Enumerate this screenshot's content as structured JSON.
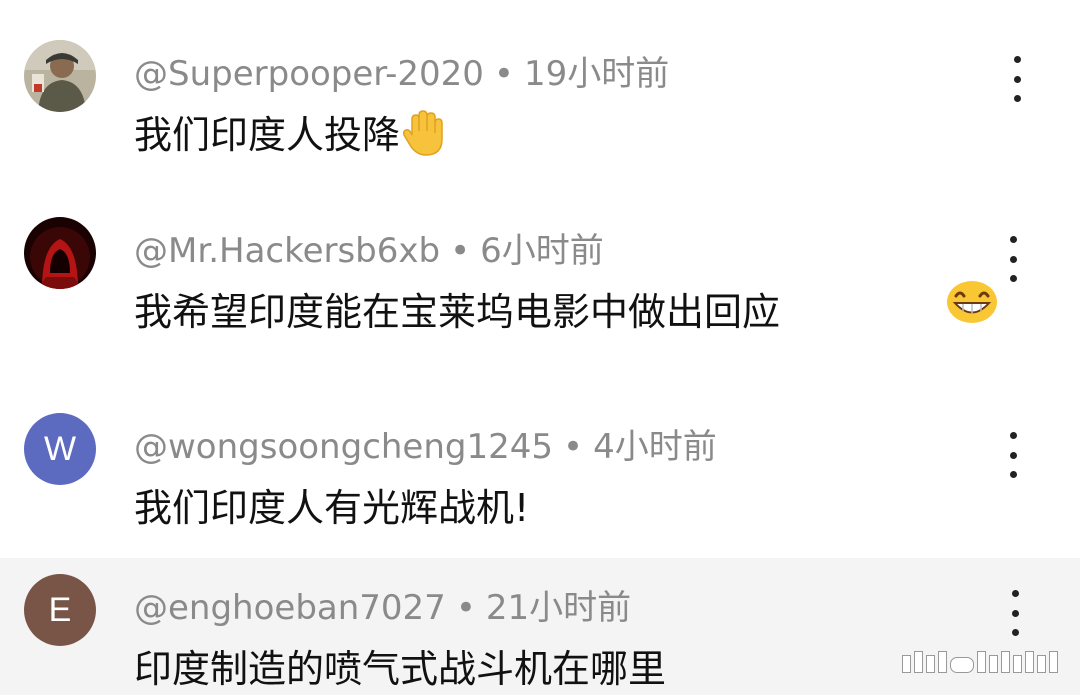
{
  "comments": [
    {
      "handle": "@Superpooper-2020",
      "time": "19小时前",
      "text": "我们印度人投降",
      "avatar_letter": "",
      "avatar_color": "#7a7260",
      "emoji": "raised-hand"
    },
    {
      "handle": "@Mr.Hackersb6xb",
      "time": "6小时前",
      "text": "我希望印度能在宝莱坞电影中做出回应",
      "avatar_letter": "",
      "avatar_color": "#2b0505",
      "emoji": "grinning-face"
    },
    {
      "handle": "@wongsoongcheng1245",
      "time": "4小时前",
      "text": "我们印度人有光辉战机!",
      "avatar_letter": "W",
      "avatar_color": "#5c6bc0",
      "emoji": ""
    },
    {
      "handle": "@enghoeban7027",
      "time": "21小时前",
      "text": "印度制造的喷气式战斗机在哪里",
      "avatar_letter": "E",
      "avatar_color": "#795548",
      "emoji": ""
    }
  ],
  "separator": "•",
  "colors": {
    "meta_text": "#8a8a8a",
    "body_text": "#111111",
    "highlight_bg": "#f4f4f4"
  }
}
